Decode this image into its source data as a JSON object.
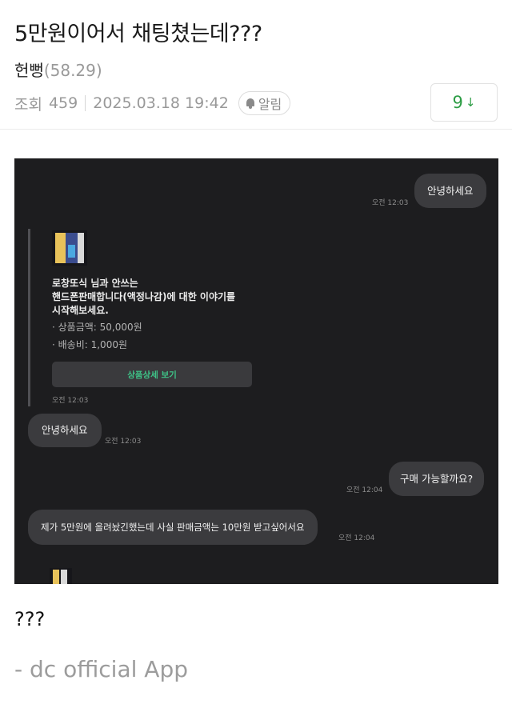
{
  "post": {
    "title": "5만원이어서 채팅쳤는데???",
    "author": "헌뻥",
    "author_ip": "(58.29)",
    "views_label": "조회",
    "views": "459",
    "date": "2025.03.18 19:42",
    "alarm_label": "알림",
    "comment_count": "9",
    "comment_arrow": "↓",
    "body": "???",
    "source": "- dc official App"
  },
  "chat": {
    "messages": [
      {
        "side": "right",
        "text": "안녕하세요",
        "time": "오전 12:03"
      },
      {
        "side": "left",
        "text": "안녕하세요",
        "time": "오전 12:03"
      },
      {
        "side": "right",
        "text": "구매 가능할까요?",
        "time": "오전 12:04"
      },
      {
        "side": "left",
        "text": "제가 5만원에 올려놨긴했는데 사실 판매금액는 10만원 받고싶어서요",
        "time": "오전 12:04"
      }
    ],
    "card": {
      "line1": "로창또식 님과 안쓰는",
      "line2": "핸드폰판매합니다(액정나감)에 대한 이야기를",
      "line3": "시작해보세요.",
      "price": "· 상품금액: 50,000원",
      "shipping": "· 배송비: 1,000원",
      "button": "상품상세 보기",
      "time": "오전 12:03"
    }
  },
  "colors": {
    "chat_bg": "#1d1d1f",
    "bubble": "#3b3b3e",
    "accent_green": "#2e9d46",
    "detail_green": "#3ec488"
  }
}
